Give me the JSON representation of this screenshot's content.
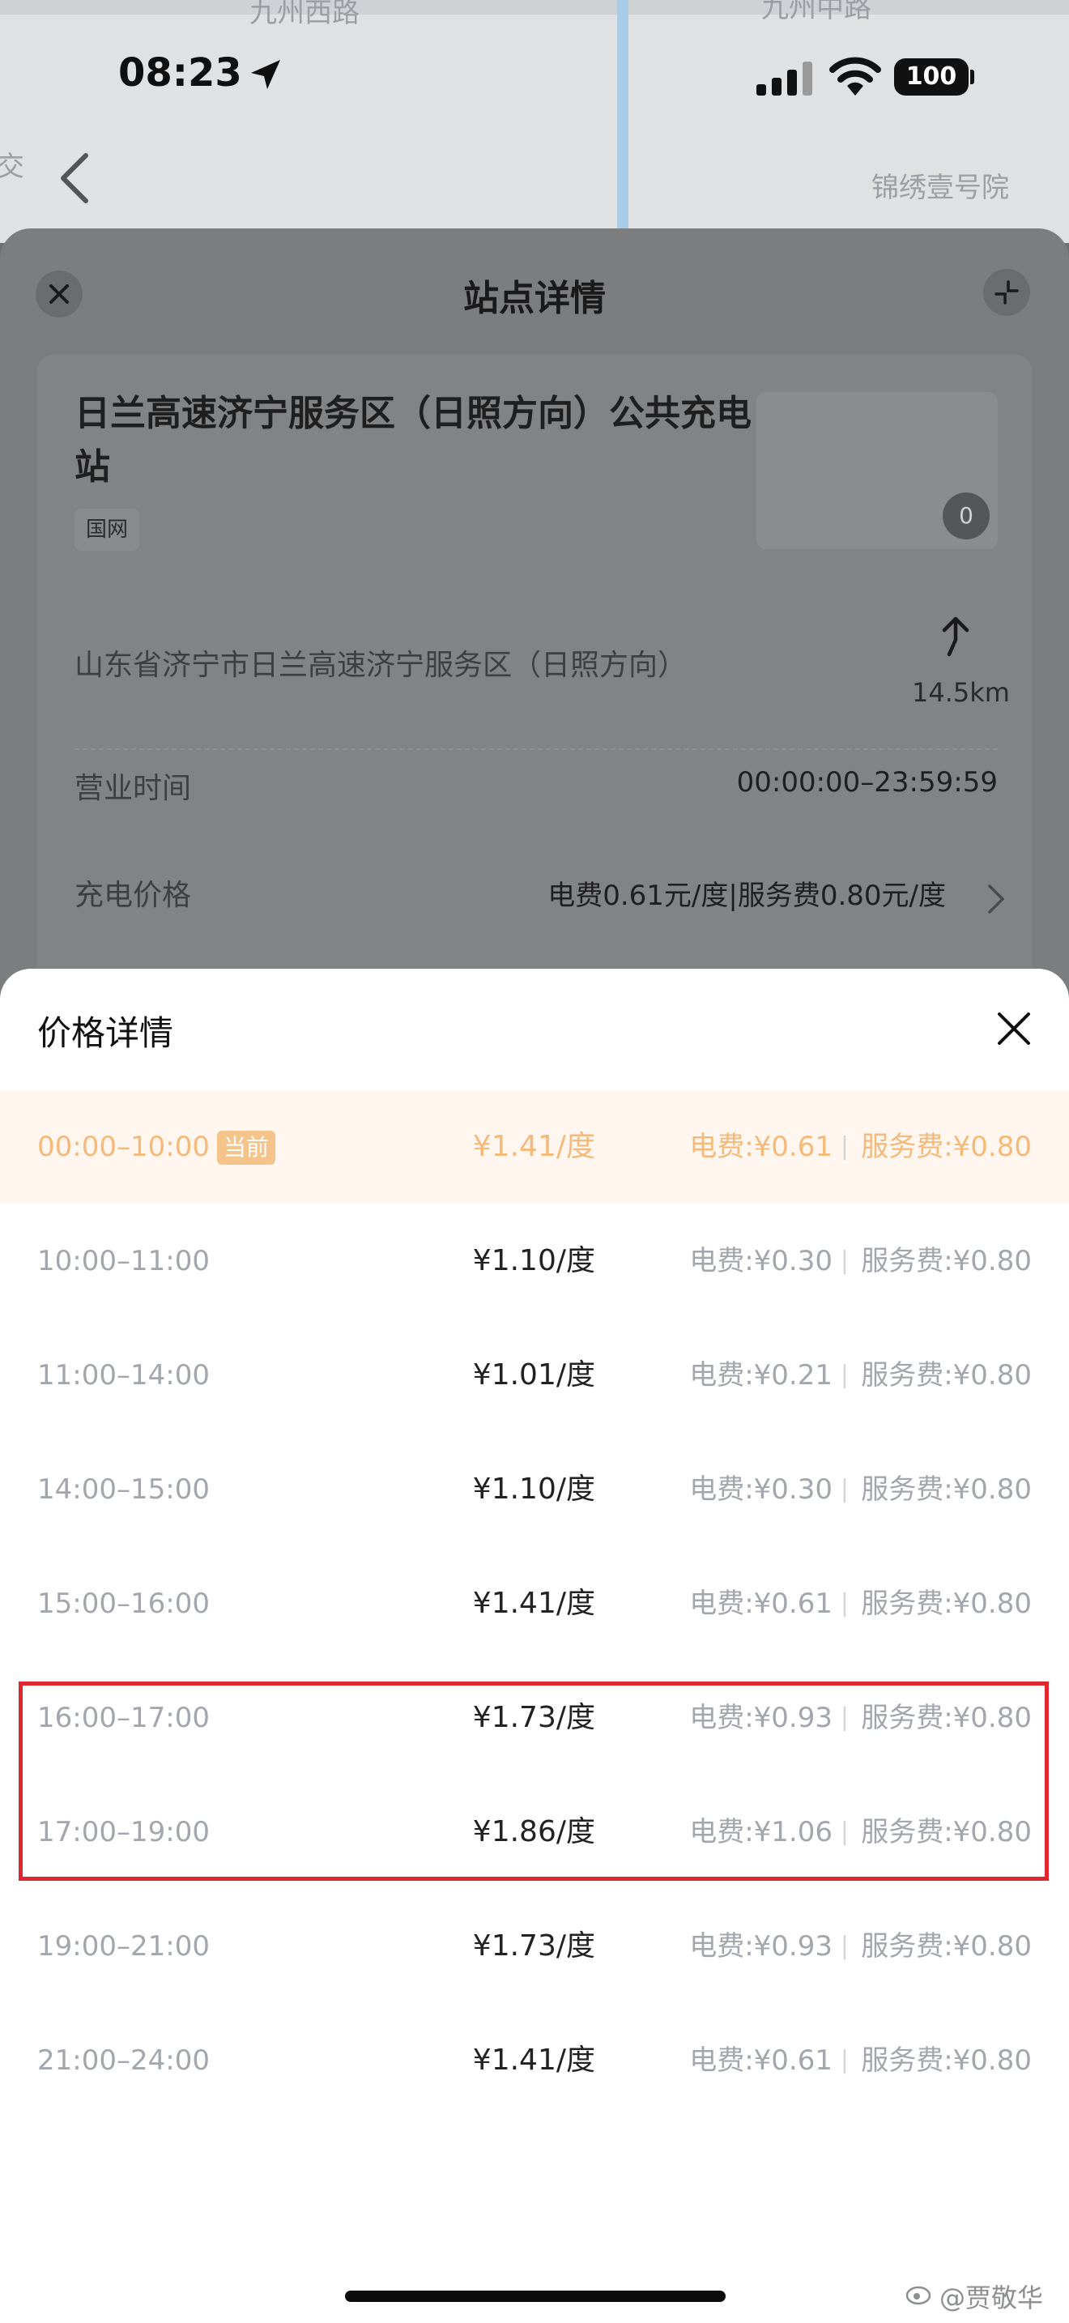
{
  "status_bar": {
    "time": "08:23",
    "battery": "100"
  },
  "map": {
    "labels": [
      "九州西路",
      "九州中路",
      "锦绣壹号院",
      "交"
    ]
  },
  "detail_sheet": {
    "title": "站点详情",
    "station_name": "日兰高速济宁服务区（日照方向）公共充电站",
    "operator_tag": "国网",
    "photo_count": "0",
    "address": "山东省济宁市日兰高速济宁服务区（日照方向）",
    "distance": "14.5km",
    "hours_label": "营业时间",
    "hours_value": "00:00:00–23:59:59",
    "price_label": "充电价格",
    "price_value": "电费0.61元/度|服务费0.80元/度"
  },
  "price_sheet": {
    "title": "价格详情",
    "current_badge": "当前",
    "separator": "|",
    "rows": [
      {
        "time": "00:00–10:00",
        "total": "¥1.41/度",
        "elec": "电费:¥0.61",
        "svc": "服务费:¥0.80"
      },
      {
        "time": "10:00–11:00",
        "total": "¥1.10/度",
        "elec": "电费:¥0.30",
        "svc": "服务费:¥0.80"
      },
      {
        "time": "11:00–14:00",
        "total": "¥1.01/度",
        "elec": "电费:¥0.21",
        "svc": "服务费:¥0.80"
      },
      {
        "time": "14:00–15:00",
        "total": "¥1.10/度",
        "elec": "电费:¥0.30",
        "svc": "服务费:¥0.80"
      },
      {
        "time": "15:00–16:00",
        "total": "¥1.41/度",
        "elec": "电费:¥0.61",
        "svc": "服务费:¥0.80"
      },
      {
        "time": "16:00–17:00",
        "total": "¥1.73/度",
        "elec": "电费:¥0.93",
        "svc": "服务费:¥0.80"
      },
      {
        "time": "17:00–19:00",
        "total": "¥1.86/度",
        "elec": "电费:¥1.06",
        "svc": "服务费:¥0.80"
      },
      {
        "time": "19:00–21:00",
        "total": "¥1.73/度",
        "elec": "电费:¥0.93",
        "svc": "服务费:¥0.80"
      },
      {
        "time": "21:00–24:00",
        "total": "¥1.41/度",
        "elec": "电费:¥0.61",
        "svc": "服务费:¥0.80"
      }
    ]
  },
  "watermark": "@贾敬华",
  "colors": {
    "current_row_bg": "#fff7ef",
    "current_accent": "#f5b97a",
    "highlight_border": "#e0262f"
  }
}
